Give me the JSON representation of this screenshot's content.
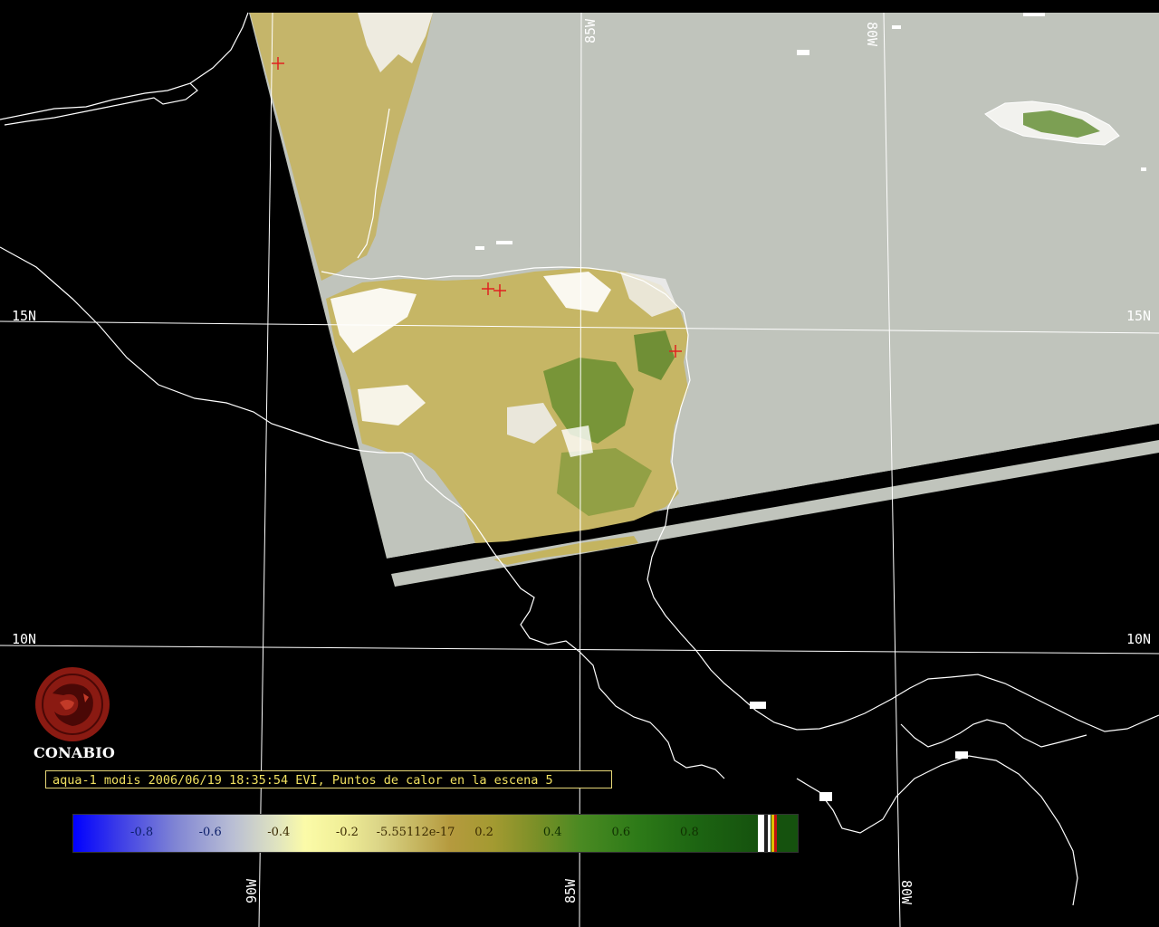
{
  "map": {
    "graticule_labels": {
      "lat_15_left": "15N",
      "lat_15_right": "15N",
      "lat_10_left": "10N",
      "lat_10_right": "10N",
      "lon_85_top": "85W",
      "lon_80_top": "80W",
      "lon_90_bottom": "90W",
      "lon_85_bottom": "85W",
      "lon_80_bottom": "80W"
    },
    "hotspot_marker_color": "#e02020",
    "coastline_color": "#ffffff",
    "no_data_color": "#c0c4bc"
  },
  "logo": {
    "text": "CONABIO",
    "color": "#8a1a12"
  },
  "caption": {
    "text": "aqua-1 modis 2006/06/19 18:35:54 EVI, Puntos de calor en la escena 5"
  },
  "colorbar": {
    "ticks": [
      "-0.8",
      "-0.6",
      "-0.4",
      "-0.2",
      "-5.55112e-17",
      "0.2",
      "0.4",
      "0.6",
      "0.8"
    ],
    "tick_values": [
      -0.8,
      -0.6,
      -0.4,
      -0.2,
      -5.55112e-17,
      0.2,
      0.4,
      0.6,
      0.8
    ],
    "range": [
      -1.0,
      1.0
    ],
    "special_colors": [
      "#ffffff",
      "#202020",
      "#ffffff",
      "#e0c000",
      "#c01010"
    ]
  }
}
